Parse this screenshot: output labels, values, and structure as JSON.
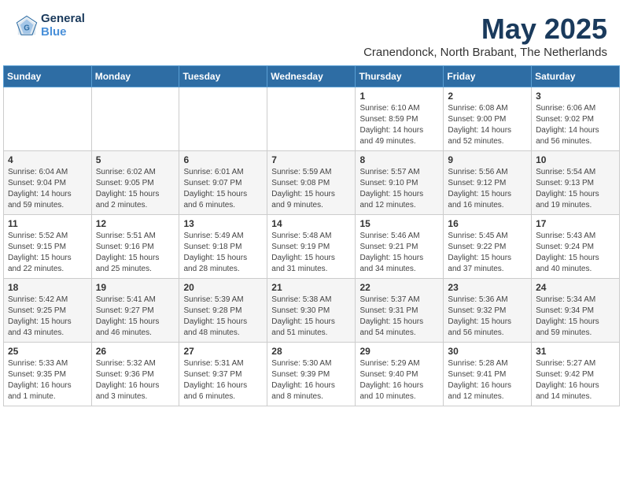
{
  "logo": {
    "line1": "General",
    "line2": "Blue"
  },
  "header": {
    "month": "May 2025",
    "location": "Cranendonck, North Brabant, The Netherlands"
  },
  "weekdays": [
    "Sunday",
    "Monday",
    "Tuesday",
    "Wednesday",
    "Thursday",
    "Friday",
    "Saturday"
  ],
  "weeks": [
    [
      {
        "day": "",
        "info": ""
      },
      {
        "day": "",
        "info": ""
      },
      {
        "day": "",
        "info": ""
      },
      {
        "day": "",
        "info": ""
      },
      {
        "day": "1",
        "info": "Sunrise: 6:10 AM\nSunset: 8:59 PM\nDaylight: 14 hours\nand 49 minutes."
      },
      {
        "day": "2",
        "info": "Sunrise: 6:08 AM\nSunset: 9:00 PM\nDaylight: 14 hours\nand 52 minutes."
      },
      {
        "day": "3",
        "info": "Sunrise: 6:06 AM\nSunset: 9:02 PM\nDaylight: 14 hours\nand 56 minutes."
      }
    ],
    [
      {
        "day": "4",
        "info": "Sunrise: 6:04 AM\nSunset: 9:04 PM\nDaylight: 14 hours\nand 59 minutes."
      },
      {
        "day": "5",
        "info": "Sunrise: 6:02 AM\nSunset: 9:05 PM\nDaylight: 15 hours\nand 2 minutes."
      },
      {
        "day": "6",
        "info": "Sunrise: 6:01 AM\nSunset: 9:07 PM\nDaylight: 15 hours\nand 6 minutes."
      },
      {
        "day": "7",
        "info": "Sunrise: 5:59 AM\nSunset: 9:08 PM\nDaylight: 15 hours\nand 9 minutes."
      },
      {
        "day": "8",
        "info": "Sunrise: 5:57 AM\nSunset: 9:10 PM\nDaylight: 15 hours\nand 12 minutes."
      },
      {
        "day": "9",
        "info": "Sunrise: 5:56 AM\nSunset: 9:12 PM\nDaylight: 15 hours\nand 16 minutes."
      },
      {
        "day": "10",
        "info": "Sunrise: 5:54 AM\nSunset: 9:13 PM\nDaylight: 15 hours\nand 19 minutes."
      }
    ],
    [
      {
        "day": "11",
        "info": "Sunrise: 5:52 AM\nSunset: 9:15 PM\nDaylight: 15 hours\nand 22 minutes."
      },
      {
        "day": "12",
        "info": "Sunrise: 5:51 AM\nSunset: 9:16 PM\nDaylight: 15 hours\nand 25 minutes."
      },
      {
        "day": "13",
        "info": "Sunrise: 5:49 AM\nSunset: 9:18 PM\nDaylight: 15 hours\nand 28 minutes."
      },
      {
        "day": "14",
        "info": "Sunrise: 5:48 AM\nSunset: 9:19 PM\nDaylight: 15 hours\nand 31 minutes."
      },
      {
        "day": "15",
        "info": "Sunrise: 5:46 AM\nSunset: 9:21 PM\nDaylight: 15 hours\nand 34 minutes."
      },
      {
        "day": "16",
        "info": "Sunrise: 5:45 AM\nSunset: 9:22 PM\nDaylight: 15 hours\nand 37 minutes."
      },
      {
        "day": "17",
        "info": "Sunrise: 5:43 AM\nSunset: 9:24 PM\nDaylight: 15 hours\nand 40 minutes."
      }
    ],
    [
      {
        "day": "18",
        "info": "Sunrise: 5:42 AM\nSunset: 9:25 PM\nDaylight: 15 hours\nand 43 minutes."
      },
      {
        "day": "19",
        "info": "Sunrise: 5:41 AM\nSunset: 9:27 PM\nDaylight: 15 hours\nand 46 minutes."
      },
      {
        "day": "20",
        "info": "Sunrise: 5:39 AM\nSunset: 9:28 PM\nDaylight: 15 hours\nand 48 minutes."
      },
      {
        "day": "21",
        "info": "Sunrise: 5:38 AM\nSunset: 9:30 PM\nDaylight: 15 hours\nand 51 minutes."
      },
      {
        "day": "22",
        "info": "Sunrise: 5:37 AM\nSunset: 9:31 PM\nDaylight: 15 hours\nand 54 minutes."
      },
      {
        "day": "23",
        "info": "Sunrise: 5:36 AM\nSunset: 9:32 PM\nDaylight: 15 hours\nand 56 minutes."
      },
      {
        "day": "24",
        "info": "Sunrise: 5:34 AM\nSunset: 9:34 PM\nDaylight: 15 hours\nand 59 minutes."
      }
    ],
    [
      {
        "day": "25",
        "info": "Sunrise: 5:33 AM\nSunset: 9:35 PM\nDaylight: 16 hours\nand 1 minute."
      },
      {
        "day": "26",
        "info": "Sunrise: 5:32 AM\nSunset: 9:36 PM\nDaylight: 16 hours\nand 3 minutes."
      },
      {
        "day": "27",
        "info": "Sunrise: 5:31 AM\nSunset: 9:37 PM\nDaylight: 16 hours\nand 6 minutes."
      },
      {
        "day": "28",
        "info": "Sunrise: 5:30 AM\nSunset: 9:39 PM\nDaylight: 16 hours\nand 8 minutes."
      },
      {
        "day": "29",
        "info": "Sunrise: 5:29 AM\nSunset: 9:40 PM\nDaylight: 16 hours\nand 10 minutes."
      },
      {
        "day": "30",
        "info": "Sunrise: 5:28 AM\nSunset: 9:41 PM\nDaylight: 16 hours\nand 12 minutes."
      },
      {
        "day": "31",
        "info": "Sunrise: 5:27 AM\nSunset: 9:42 PM\nDaylight: 16 hours\nand 14 minutes."
      }
    ]
  ]
}
